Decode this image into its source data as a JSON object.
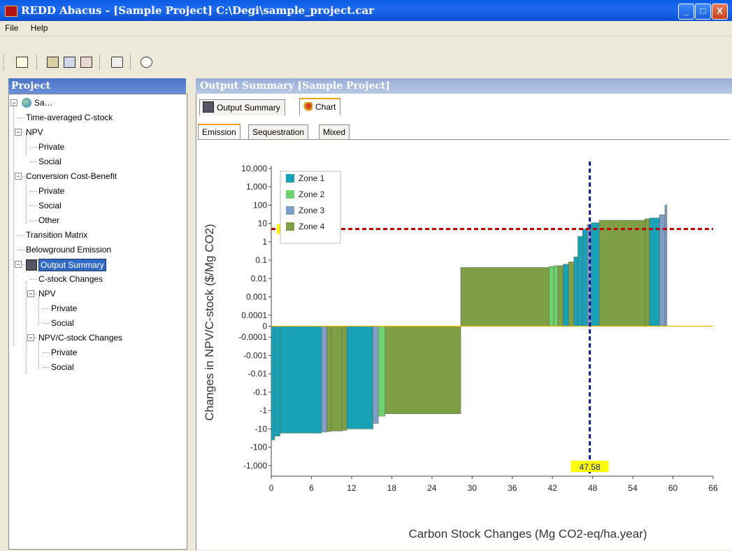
{
  "window": {
    "title": "REDD Abacus - [Sample Project] C:\\Degi\\sample_project.car",
    "controls": {
      "minimize": "_",
      "maximize": "□",
      "close": "X"
    }
  },
  "menu": {
    "items": [
      "File",
      "Help"
    ]
  },
  "toolbar": {
    "buttons": [
      "new-icon",
      "open-icon",
      "save-icon",
      "save-as-icon",
      "pointer-help-icon",
      "about-icon"
    ]
  },
  "project_panel": {
    "title": "Project",
    "tree": [
      {
        "label": "Sa…",
        "level": 0,
        "icon": "globe-icon",
        "expanded": true
      },
      {
        "label": "Time-averaged C-stock",
        "level": 1
      },
      {
        "label": "NPV",
        "level": 1,
        "expanded": true
      },
      {
        "label": "Private",
        "level": 2
      },
      {
        "label": "Social",
        "level": 2
      },
      {
        "label": "Conversion Cost-Benefit",
        "level": 1,
        "expanded": true
      },
      {
        "label": "Private",
        "level": 2
      },
      {
        "label": "Social",
        "level": 2
      },
      {
        "label": "Other",
        "level": 2
      },
      {
        "label": "Transition Matrix",
        "level": 1
      },
      {
        "label": "Belowground Emission",
        "level": 1
      },
      {
        "label": "Output Summary",
        "level": 1,
        "expanded": true,
        "selected": true,
        "icon": "calculator-icon"
      },
      {
        "label": "C-stock Changes",
        "level": 2
      },
      {
        "label": "NPV",
        "level": 2,
        "expanded": true
      },
      {
        "label": "Private",
        "level": 3
      },
      {
        "label": "Social",
        "level": 3
      },
      {
        "label": "NPV/C-stock Changes",
        "level": 2,
        "expanded": true
      },
      {
        "label": "Private",
        "level": 3
      },
      {
        "label": "Social",
        "level": 3
      }
    ]
  },
  "output_panel": {
    "title": "Output Summary [Sample Project]",
    "tabs": [
      {
        "label": "Output Summary",
        "icon": "calculator-icon",
        "active": false
      },
      {
        "label": "Chart",
        "icon": "chart-icon",
        "active": true
      }
    ],
    "subtabs": [
      {
        "label": "Emission",
        "active": true
      },
      {
        "label": "Sequestration",
        "active": false
      },
      {
        "label": "Mixed",
        "active": false
      }
    ]
  },
  "chart_data": {
    "type": "bar",
    "xlabel": "Carbon Stock Changes (Mg CO2-eq/ha.year)",
    "ylabel": "Changes in NPV/C-stock ($/Mg CO2)",
    "x_ticks": [
      "0",
      "6",
      "12",
      "18",
      "24",
      "30",
      "36",
      "42",
      "48",
      "54",
      "60",
      "66"
    ],
    "xlim": [
      0,
      66
    ],
    "y_scale": "symlog",
    "y_ticks": [
      "10,000",
      "1,000",
      "100",
      "10",
      "1",
      "0.1",
      "0.01",
      "0.001",
      "0.0001",
      "0",
      "-0.0001",
      "-0.001",
      "-0.01",
      "-0.1",
      "-1",
      "-10",
      "-100",
      "-1,000"
    ],
    "y_tick_values": [
      10000,
      1000,
      100,
      10,
      1,
      0.1,
      0.01,
      0.001,
      0.0001,
      0,
      -0.0001,
      -0.001,
      -0.01,
      -0.1,
      -1,
      -10,
      -100,
      -1000
    ],
    "legend": [
      "Zone 1",
      "Zone 2",
      "Zone 3",
      "Zone 4"
    ],
    "legend_position": "top-left",
    "colors": {
      "Zone 1": "#17a2b8",
      "Zone 2": "#6fd46f",
      "Zone 3": "#7f9fc8",
      "Zone 4": "#7f9f45"
    },
    "threshold_price": {
      "value": 5,
      "label": "5"
    },
    "threshold_emission": {
      "value": 47.58,
      "label": "47.58"
    },
    "bars": [
      {
        "x0": 0,
        "x1": 0.5,
        "y": -40,
        "zone": "Zone 1"
      },
      {
        "x0": 0.5,
        "x1": 1.3,
        "y": -25,
        "zone": "Zone 1"
      },
      {
        "x0": 1.3,
        "x1": 7.5,
        "y": -17,
        "zone": "Zone 1"
      },
      {
        "x0": 7.5,
        "x1": 8.3,
        "y": -15,
        "zone": "Zone 3"
      },
      {
        "x0": 8.3,
        "x1": 8.9,
        "y": -14,
        "zone": "Zone 4"
      },
      {
        "x0": 8.9,
        "x1": 10.6,
        "y": -13,
        "zone": "Zone 4"
      },
      {
        "x0": 10.6,
        "x1": 11.3,
        "y": -12,
        "zone": "Zone 4"
      },
      {
        "x0": 11.3,
        "x1": 15.2,
        "y": -10,
        "zone": "Zone 1"
      },
      {
        "x0": 15.2,
        "x1": 16.0,
        "y": -5,
        "zone": "Zone 3"
      },
      {
        "x0": 16.0,
        "x1": 17.0,
        "y": -2,
        "zone": "Zone 2"
      },
      {
        "x0": 17.0,
        "x1": 28.3,
        "y": -1.5,
        "zone": "Zone 4"
      },
      {
        "x0": 28.3,
        "x1": 41.5,
        "y": 0.04,
        "zone": "Zone 4"
      },
      {
        "x0": 41.5,
        "x1": 42.2,
        "y": 0.045,
        "zone": "Zone 2"
      },
      {
        "x0": 42.2,
        "x1": 42.8,
        "y": 0.05,
        "zone": "Zone 2"
      },
      {
        "x0": 42.8,
        "x1": 43.6,
        "y": 0.05,
        "zone": "Zone 4"
      },
      {
        "x0": 43.6,
        "x1": 44.4,
        "y": 0.06,
        "zone": "Zone 1"
      },
      {
        "x0": 44.4,
        "x1": 45.2,
        "y": 0.08,
        "zone": "Zone 4"
      },
      {
        "x0": 45.2,
        "x1": 45.8,
        "y": 0.15,
        "zone": "Zone 1"
      },
      {
        "x0": 45.8,
        "x1": 46.5,
        "y": 2,
        "zone": "Zone 1"
      },
      {
        "x0": 46.5,
        "x1": 47.2,
        "y": 5,
        "zone": "Zone 1"
      },
      {
        "x0": 47.2,
        "x1": 47.8,
        "y": 9,
        "zone": "Zone 3"
      },
      {
        "x0": 47.8,
        "x1": 49.0,
        "y": 11,
        "zone": "Zone 1"
      },
      {
        "x0": 49.0,
        "x1": 55.8,
        "y": 15,
        "zone": "Zone 4"
      },
      {
        "x0": 55.8,
        "x1": 56.5,
        "y": 18,
        "zone": "Zone 4"
      },
      {
        "x0": 56.5,
        "x1": 58.0,
        "y": 20,
        "zone": "Zone 1"
      },
      {
        "x0": 58.0,
        "x1": 58.8,
        "y": 30,
        "zone": "Zone 3"
      },
      {
        "x0": 58.8,
        "x1": 59.1,
        "y": 100,
        "zone": "Zone 3"
      }
    ]
  }
}
